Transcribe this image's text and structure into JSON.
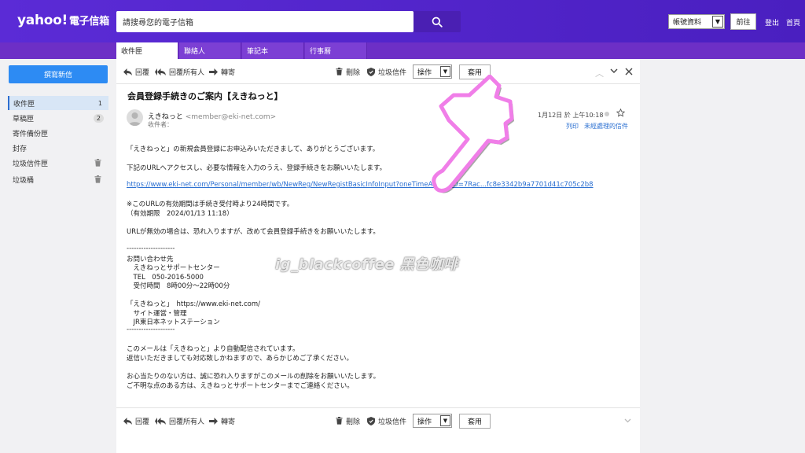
{
  "header": {
    "logo": "yahoo!",
    "logo_sub": "電子信箱",
    "search_placeholder": "請搜尋您的電子信箱",
    "account_select": "帳號資料",
    "go_label": "前往",
    "logout_label": "登出",
    "home_label": "首頁"
  },
  "tabs": [
    {
      "label": "收件匣",
      "active": true
    },
    {
      "label": "聯絡人",
      "active": false
    },
    {
      "label": "筆記本",
      "active": false
    },
    {
      "label": "行事曆",
      "active": false
    }
  ],
  "sidebar": {
    "compose_label": "撰寫新信",
    "folders": [
      {
        "label": "收件匣",
        "count": "1",
        "active": true
      },
      {
        "label": "草稿匣",
        "count": "2",
        "active": false
      },
      {
        "label": "寄件備份匣",
        "count": "",
        "active": false
      },
      {
        "label": "封存",
        "count": "",
        "active": false
      },
      {
        "label": "垃圾信件匣",
        "count": "",
        "active": false
      },
      {
        "label": "垃圾桶",
        "count": "",
        "active": false
      }
    ]
  },
  "toolbar": {
    "reply": "回覆",
    "reply_all": "回覆所有人",
    "forward": "轉寄",
    "delete": "刪除",
    "spam": "垃圾信件",
    "action_select": "操作",
    "apply": "套用"
  },
  "message": {
    "subject": "会員登録手続きのご案内【えきねっと】",
    "sender_name": "えきねっと",
    "sender_email": "<member@eki-net.com>",
    "recipient_label": "收件者：",
    "datetime": "1月12日 於 上午10:18",
    "print_label": "列印",
    "unread_label": "未經處理的信件",
    "body": [
      "「えきねっと」の新規会員登録にお申込みいただきまして、ありがとうございます。",
      "下記のURLへアクセスし、必要な情報を入力のうえ、登録手続きをお願いいたします。",
      "https://www.eki-net.com/Personal/member/wb/NewReg/NewRegistBasicInfoInput?oneTimeAccessID=7Rac...fc8e3342b9a7701d41c705c2b8",
      "※このURLの有効期間は手続き受付時より24時間です。",
      "（有効期限　2024/01/13 11:18）",
      "URLが無効の場合は、恐れ入りますが、改めて会員登録手続きをお願いいたします。",
      "--------------------",
      "お問い合わせ先",
      "　えきねっとサポートセンター",
      "　TEL　050-2016-5000",
      "　受付時間　8時00分～22時00分",
      "「えきねっと」　https://www.eki-net.com/",
      "　サイト運営・管理",
      "　JR東日本ネットステーション",
      "--------------------",
      "このメールは「えきねっと」より自動配信されています。",
      "返信いただきましても対応致しかねますので、あらかじめご了承ください。",
      "お心当たりのない方は、誠に恐れ入りますがこのメールの削除をお願いいたします。",
      "ご不明な点のある方は、えきねっとサポートセンターまでご連絡ください。"
    ]
  },
  "watermark": "ig_blackcoffee  黑色咖啡",
  "colors": {
    "header_purple": "#5b2bd6",
    "tab_purple": "#6d2fc6",
    "compose_blue": "#2d8bf3",
    "link_blue": "#2a6fd1",
    "hand_pink": "#f07ee8"
  }
}
